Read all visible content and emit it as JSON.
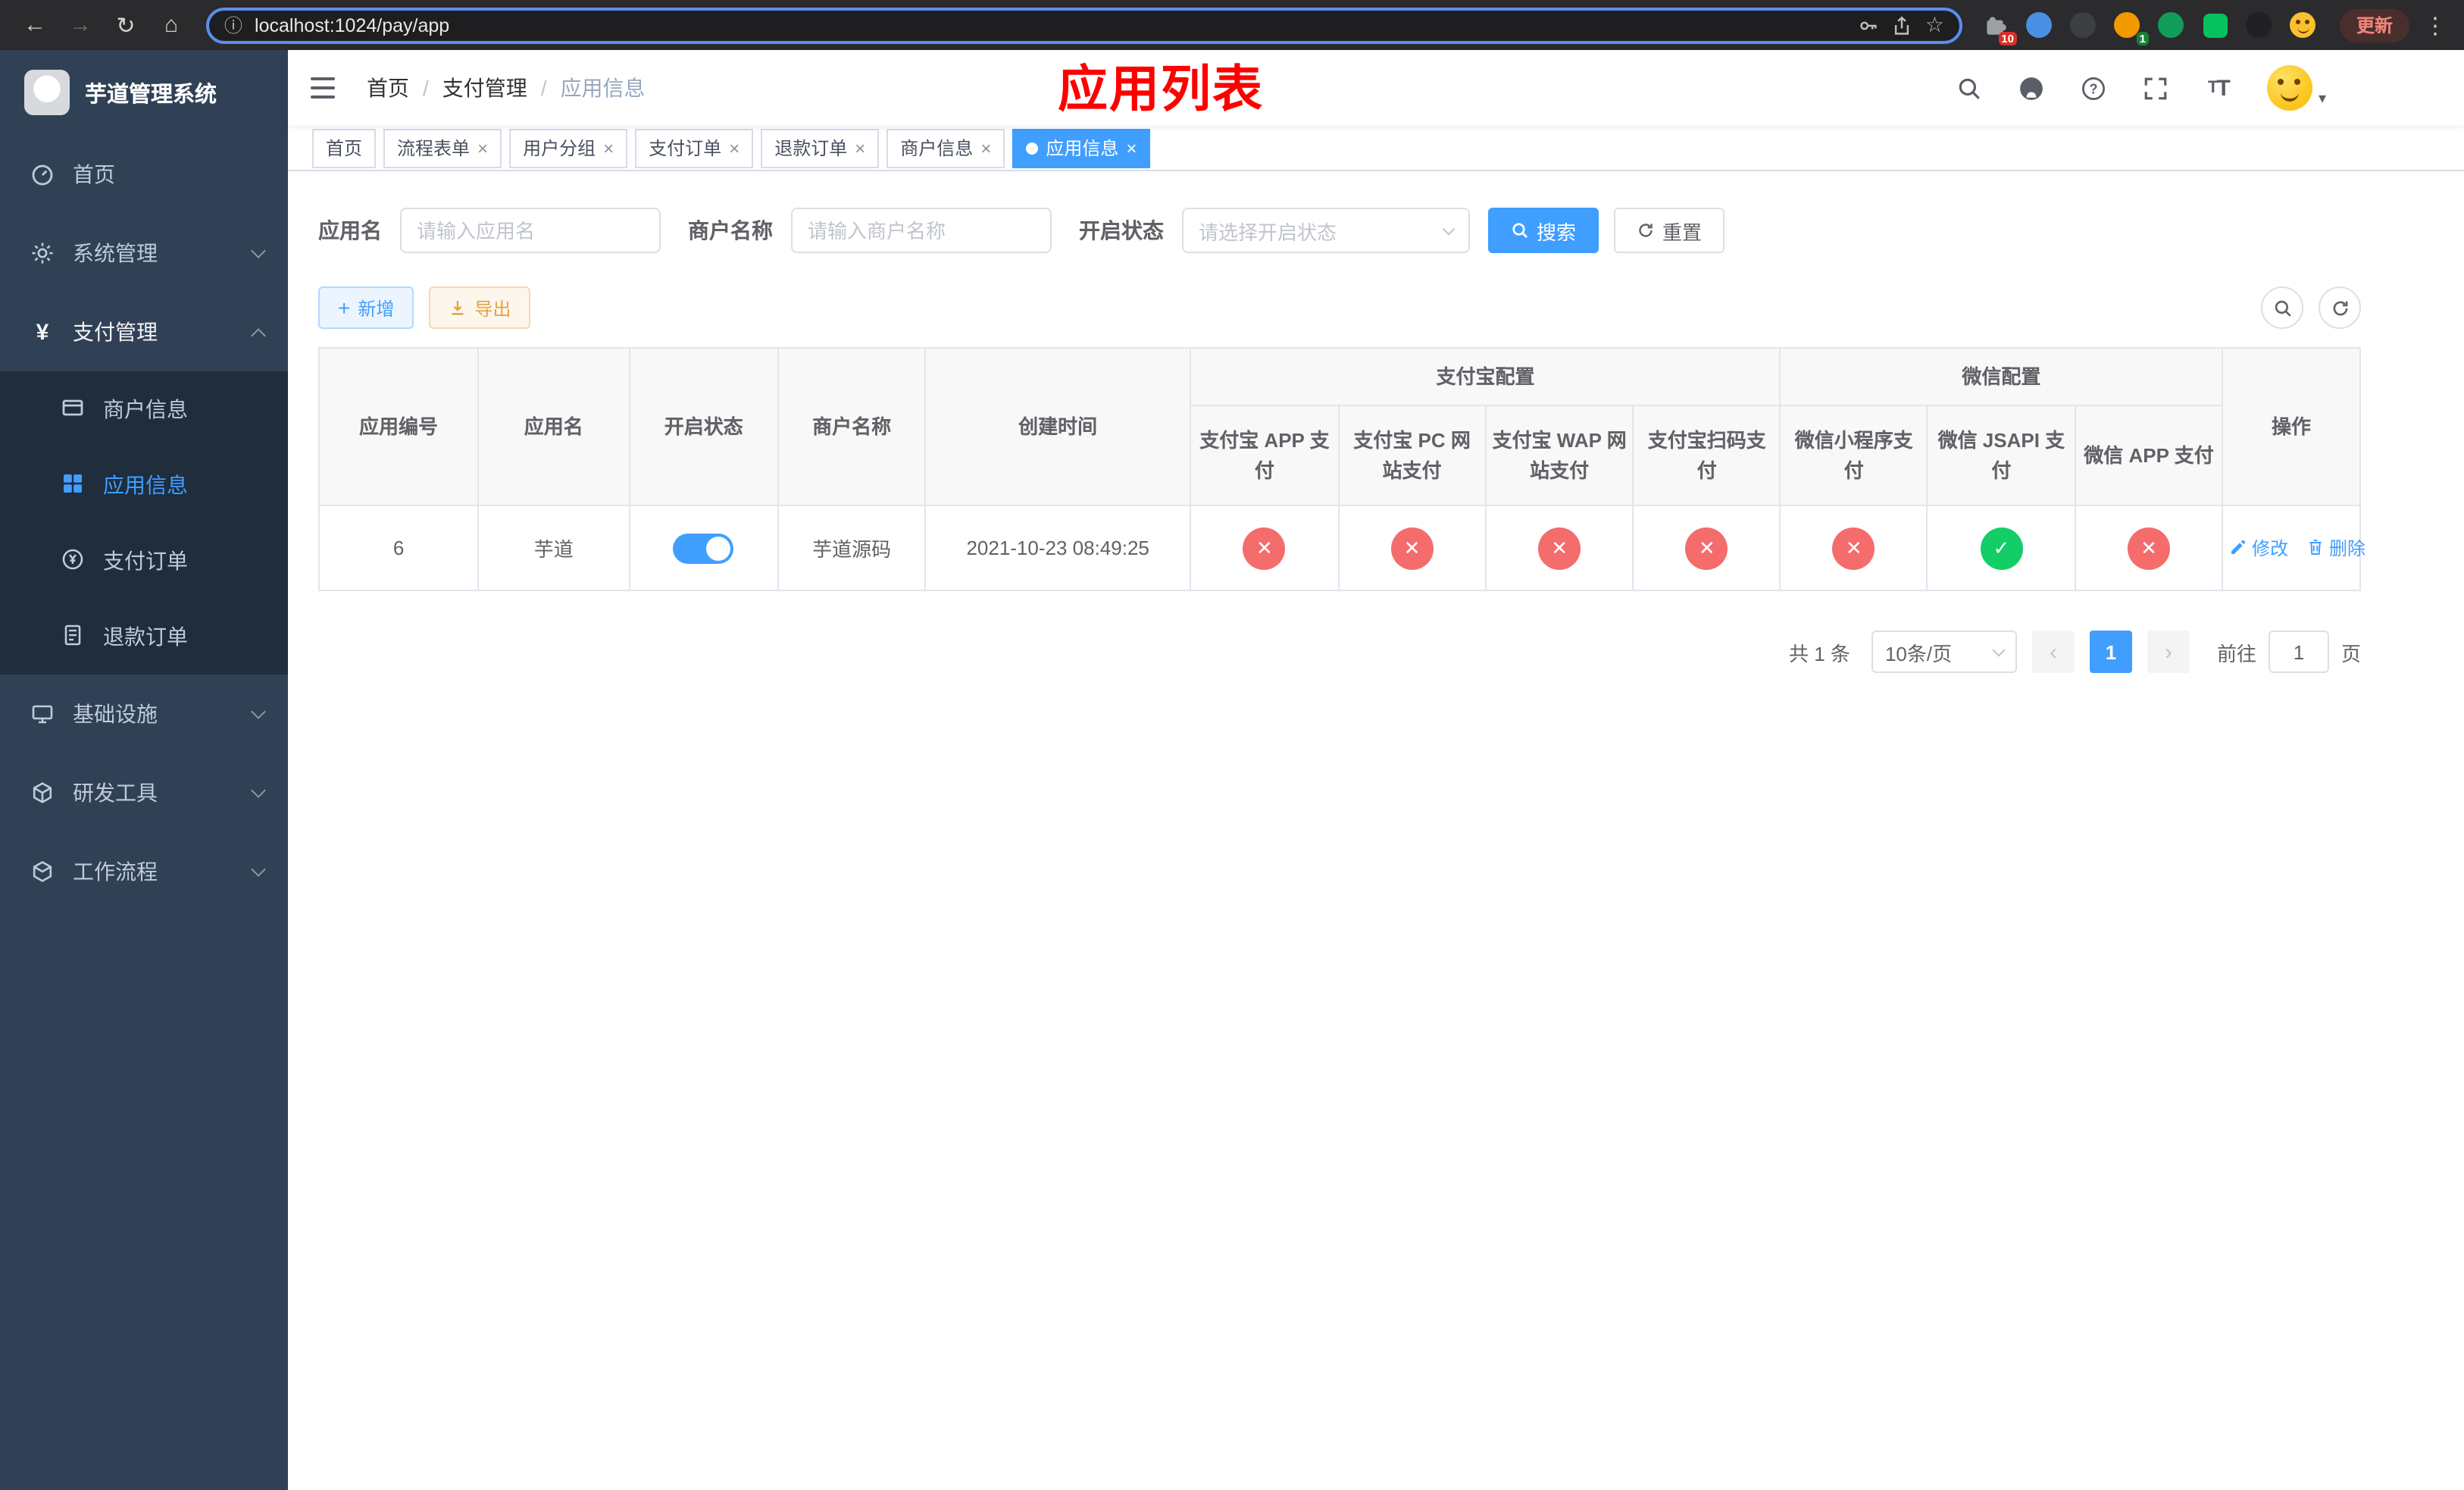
{
  "colors": {
    "accent": "#409eff",
    "success": "#13ce66",
    "danger": "#f56c6c",
    "warning": "#e6a23c",
    "overlay_title": "#ff0000",
    "sidebar_bg": "#304156",
    "sidebar_submenu_bg": "#1f2d3d"
  },
  "browser": {
    "back_icon": "←",
    "forward_icon": "→",
    "reload_icon": "↻",
    "home_icon": "⌂",
    "info_icon": "ⓘ",
    "url": "localhost:1024/pay/app",
    "star_icon": "☆",
    "extensions_badge": "10",
    "profile_badge": "1",
    "update_button": "更新",
    "menu_icon": "⋮"
  },
  "sidebar": {
    "app_title": "芋道管理系统",
    "menu": [
      {
        "label": "首页"
      },
      {
        "label": "系统管理"
      },
      {
        "label": "支付管理"
      },
      {
        "label": "商户信息"
      },
      {
        "label": "应用信息"
      },
      {
        "label": "支付订单"
      },
      {
        "label": "退款订单"
      },
      {
        "label": "基础设施"
      },
      {
        "label": "研发工具"
      },
      {
        "label": "工作流程"
      }
    ]
  },
  "navbar": {
    "breadcrumb": [
      {
        "label": "首页"
      },
      {
        "label": "支付管理"
      },
      {
        "label": "应用信息"
      }
    ],
    "page_title": "应用列表"
  },
  "tabs": [
    {
      "label": "首页"
    },
    {
      "label": "流程表单"
    },
    {
      "label": "用户分组"
    },
    {
      "label": "支付订单"
    },
    {
      "label": "退款订单"
    },
    {
      "label": "商户信息"
    },
    {
      "label": "应用信息"
    }
  ],
  "filters": {
    "app_name_label": "应用名",
    "app_name_placeholder": "请输入应用名",
    "merchant_label": "商户名称",
    "merchant_placeholder": "请输入商户名称",
    "status_label": "开启状态",
    "status_placeholder": "请选择开启状态",
    "search_button": "搜索",
    "reset_button": "重置"
  },
  "toolbar": {
    "add_button": "新增",
    "export_button": "导出"
  },
  "table": {
    "headers": {
      "app_id": "应用编号",
      "app_name": "应用名",
      "status": "开启状态",
      "merchant": "商户名称",
      "created_at": "创建时间",
      "alipay_group": "支付宝配置",
      "wechat_group": "微信配置",
      "alipay_app": "支付宝 APP 支付",
      "alipay_pc": "支付宝 PC 网站支付",
      "alipay_wap": "支付宝 WAP 网站支付",
      "alipay_qr": "支付宝扫码支付",
      "wechat_mini": "微信小程序支付",
      "wechat_jsapi": "微信 JSAPI 支付",
      "wechat_app": "微信 APP 支付",
      "actions": "操作"
    },
    "rows": [
      {
        "app_id": "6",
        "app_name": "芋道",
        "enabled": true,
        "merchant": "芋道源码",
        "created_at": "2021-10-23 08:49:25",
        "configs": [
          "fail",
          "fail",
          "fail",
          "fail",
          "fail",
          "success",
          "fail"
        ],
        "edit_label": "修改",
        "delete_label": "删除"
      }
    ]
  },
  "pagination": {
    "total_text": "共 1 条",
    "page_size_text": "10条/页",
    "prev_icon": "‹",
    "current_page": "1",
    "next_icon": "›",
    "goto_label": "前往",
    "goto_value": "1",
    "page_unit": "页"
  },
  "icons": {
    "check": "✓",
    "cross": "✕",
    "plus": "+"
  }
}
